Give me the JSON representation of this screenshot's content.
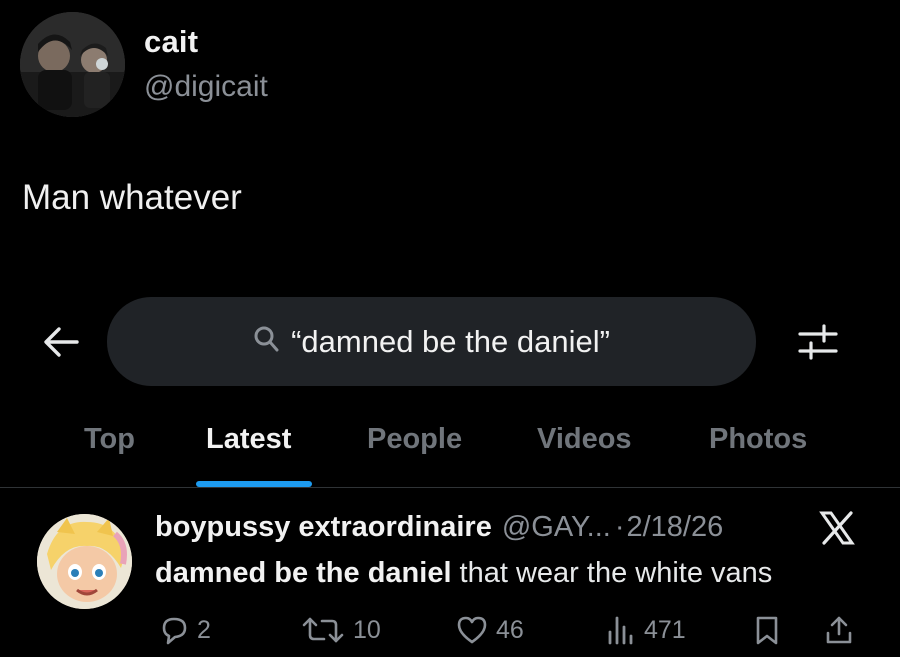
{
  "quoted_post": {
    "display_name": "cait",
    "handle": "@digicait",
    "text": "Man whatever"
  },
  "search": {
    "query": "“damned be the daniel”",
    "icons": {
      "back": "arrow-left-icon",
      "search": "search-icon",
      "filter": "filter-sliders-icon"
    }
  },
  "tabs": [
    {
      "label": "Top",
      "active": false
    },
    {
      "label": "Latest",
      "active": true
    },
    {
      "label": "People",
      "active": false
    },
    {
      "label": "Videos",
      "active": false
    },
    {
      "label": "Photos",
      "active": false
    }
  ],
  "colors": {
    "background": "#000000",
    "accent": "#1d9bf0",
    "secondary_text": "#8b9097",
    "search_box": "#202327"
  },
  "result_tweet": {
    "display_name": "boypussy extraordinaire",
    "handle": "@GAY...",
    "separator": "·",
    "date": "2/18/26",
    "text_bold": "damned be the daniel",
    "text_rest": " that wear the white vans",
    "actions": {
      "replies": "2",
      "reposts": "10",
      "likes": "46",
      "views": "471"
    }
  }
}
